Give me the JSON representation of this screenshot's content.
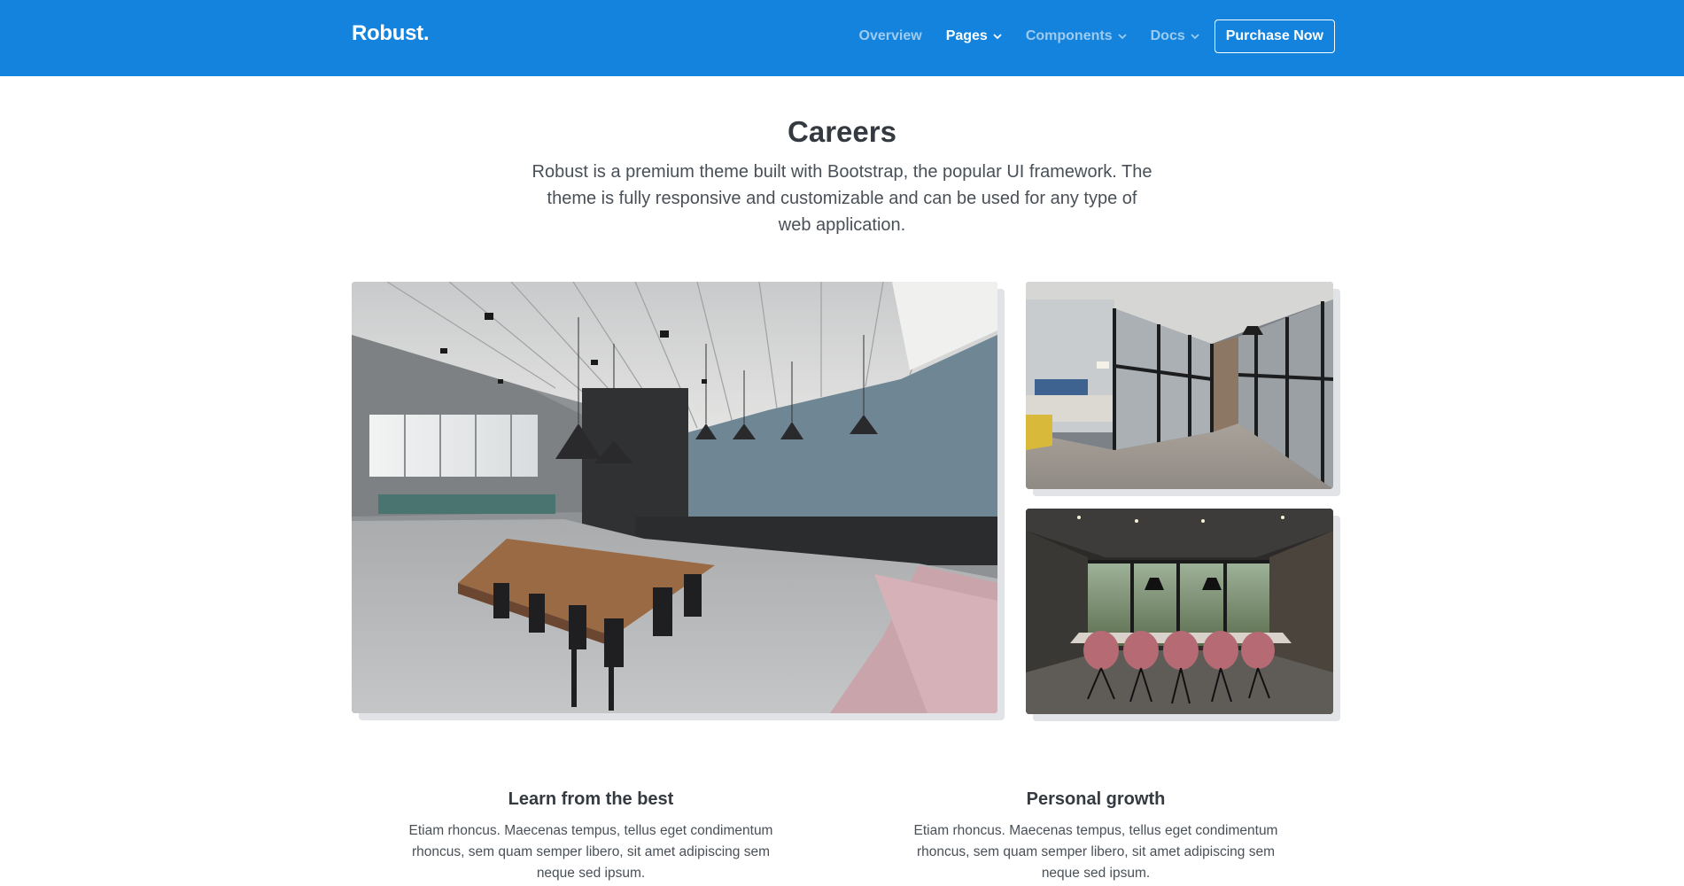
{
  "navbar": {
    "brand": "Robust.",
    "items": [
      {
        "label": "Overview",
        "dropdown": false
      },
      {
        "label": "Pages",
        "dropdown": true
      },
      {
        "label": "Components",
        "dropdown": true
      },
      {
        "label": "Docs",
        "dropdown": true
      }
    ],
    "cta_label": "Purchase Now",
    "bg_color": "#1383dd"
  },
  "hero": {
    "title": "Careers",
    "lead": "Robust is a premium theme built with Bootstrap, the popular UI framework. The theme is fully responsive and customizable and can be used for any type of web application."
  },
  "gallery": {
    "images": [
      {
        "name": "office-kitchen-photo"
      },
      {
        "name": "glass-corridor-photo"
      },
      {
        "name": "meeting-room-photo"
      }
    ]
  },
  "features": [
    {
      "title": "Learn from the best",
      "text": "Etiam rhoncus. Maecenas tempus, tellus eget condimentum rhoncus, sem quam semper libero, sit amet adipiscing sem neque sed ipsum."
    },
    {
      "title": "Personal growth",
      "text": "Etiam rhoncus. Maecenas tempus, tellus eget condimentum rhoncus, sem quam semper libero, sit amet adipiscing sem neque sed ipsum."
    }
  ]
}
